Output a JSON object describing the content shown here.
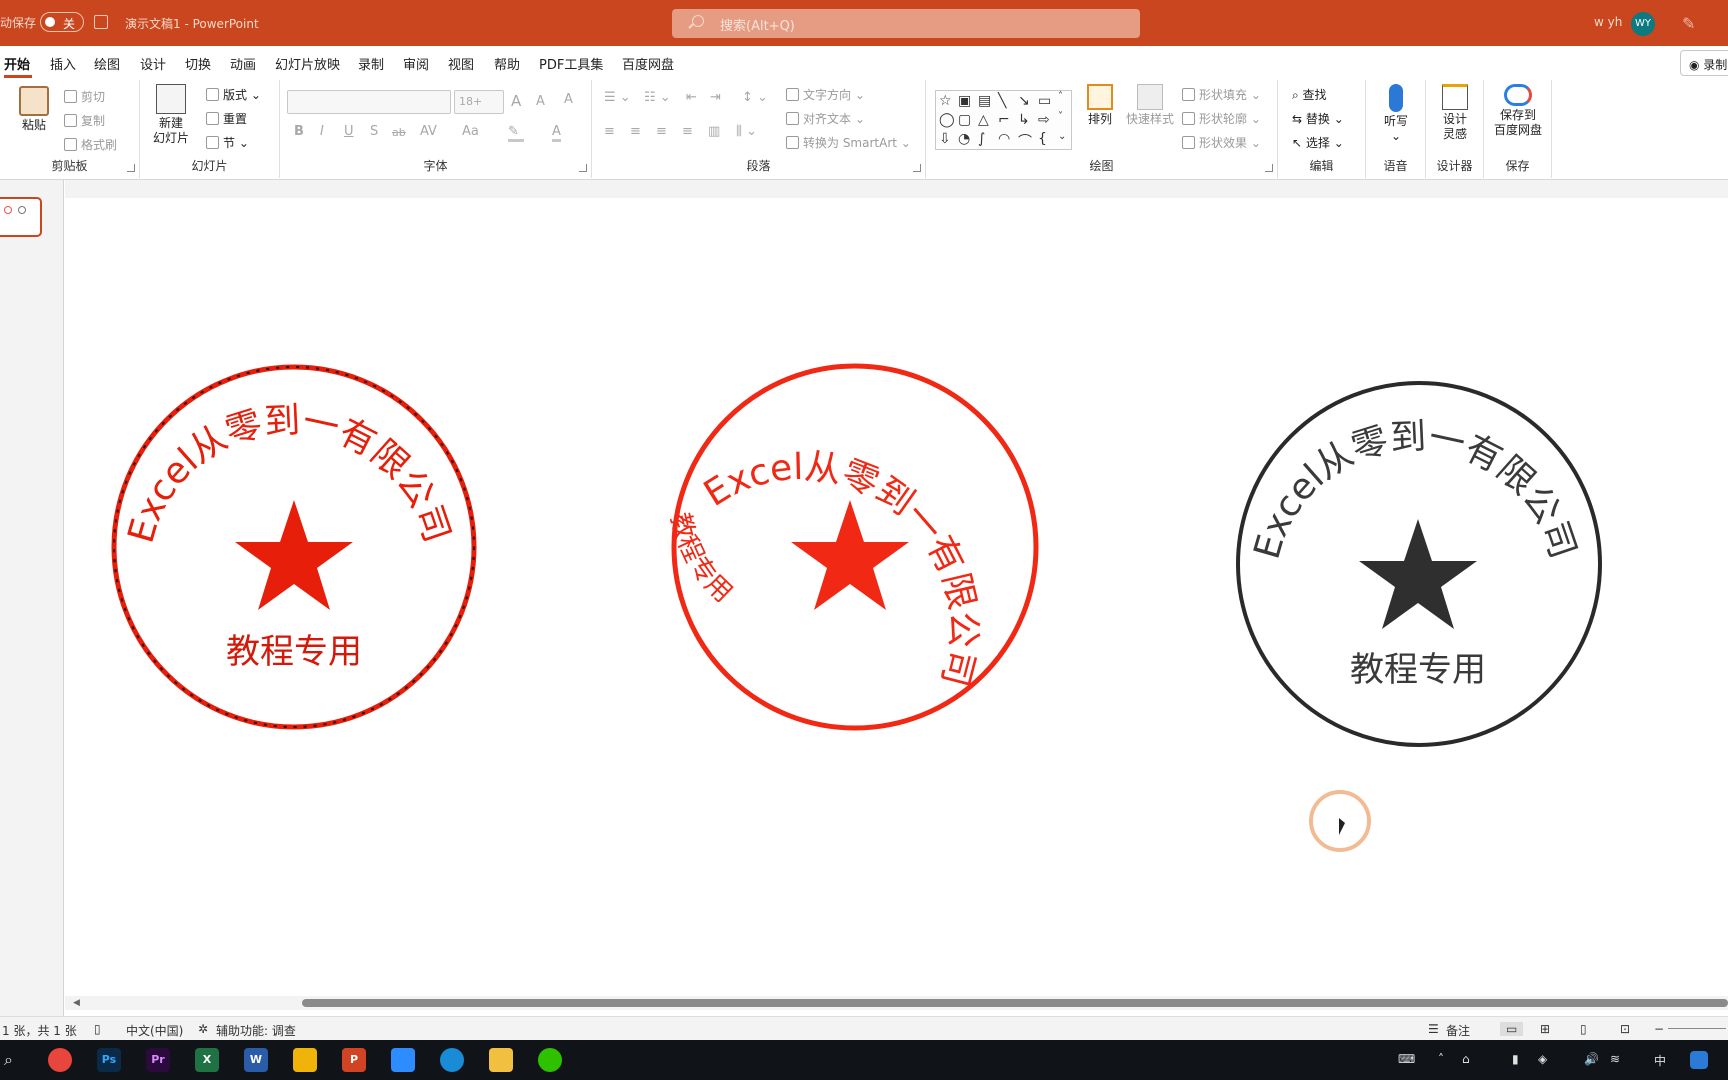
{
  "titlebar": {
    "autosave": "动保存",
    "toggle": "关",
    "doc_title": "演示文稿1 - PowerPoint",
    "search_placeholder": "搜索(Alt+Q)",
    "user_name": "w yh",
    "avatar": "WY"
  },
  "tabs": [
    "开始",
    "插入",
    "绘图",
    "设计",
    "切换",
    "动画",
    "幻灯片放映",
    "录制",
    "审阅",
    "视图",
    "帮助",
    "PDF工具集",
    "百度网盘"
  ],
  "record_button": "录制",
  "ribbon": {
    "clipboard": {
      "name": "剪贴板",
      "paste": "粘贴",
      "cut": "剪切",
      "copy": "复制",
      "format_painter": "格式刷"
    },
    "slides": {
      "name": "幻灯片",
      "new_slide_1": "新建",
      "new_slide_2": "幻灯片",
      "layout": "版式",
      "reset": "重置",
      "section": "节"
    },
    "font": {
      "name": "字体",
      "size_value": "18+",
      "bold": "B",
      "italic": "I",
      "underline": "U",
      "strike": "S",
      "shadow": "ab",
      "spacing": "AV",
      "case": "Aa",
      "grow": "A",
      "shrink": "A",
      "clear": "A",
      "font_color": "A"
    },
    "paragraph": {
      "name": "段落",
      "text_direction": "文字方向",
      "align_text": "对齐文本",
      "smartart": "转换为 SmartArt"
    },
    "drawing": {
      "name": "绘图",
      "arrange": "排列",
      "quick_styles": "快速样式",
      "shape_fill": "形状填充",
      "shape_outline": "形状轮廓",
      "shape_effects": "形状效果"
    },
    "editing": {
      "name": "编辑",
      "find": "查找",
      "replace": "替换",
      "select": "选择"
    },
    "voice": {
      "name": "语音",
      "dictate": "听写"
    },
    "designer": {
      "name": "设计器",
      "design_ideas_1": "设计",
      "design_ideas_2": "灵感"
    },
    "save": {
      "name": "保存",
      "save_baidu_1": "保存到",
      "save_baidu_2": "百度网盘"
    }
  },
  "seals": [
    {
      "top_text": "Excel从零到一有限公司",
      "bottom_text": "教程专用",
      "color": "#e61e0a"
    },
    {
      "top_text": "Excel从零到一有限公司",
      "side_text": "教程专用",
      "color": "#f02814"
    },
    {
      "top_text": "Excel从零到一有限公司",
      "bottom_text": "教程专用",
      "color": "#2a2a2a"
    }
  ],
  "status": {
    "slide_info": "1 张，共 1 张",
    "language": "中文(中国)",
    "accessibility": "辅助功能: 调查",
    "notes": "备注"
  },
  "taskbar": {
    "apps": [
      "chrome",
      "Ps",
      "Pr",
      "X",
      "W",
      "pbi",
      "P",
      "zoom",
      "edge",
      "explorer",
      "wechat"
    ],
    "tray_ime": "中"
  }
}
